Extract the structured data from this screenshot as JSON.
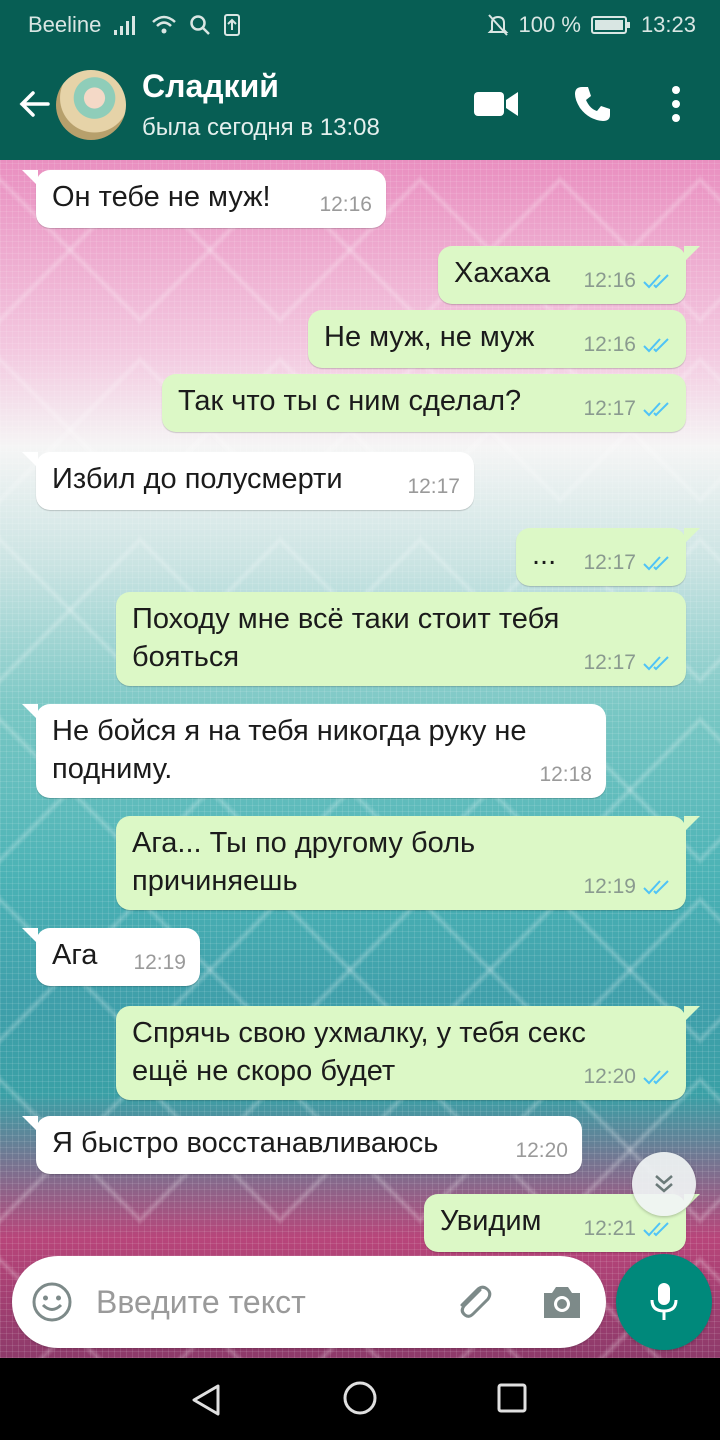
{
  "status_bar": {
    "carrier": "Beeline",
    "battery": "100 %",
    "time": "13:23",
    "icons": [
      "signal-icon",
      "wifi-icon",
      "search-icon",
      "upload-icon",
      "mute-icon",
      "battery-icon"
    ]
  },
  "header": {
    "contact_name": "Сладкий",
    "last_seen": "была сегодня в 13:08",
    "icons": [
      "back-arrow-icon",
      "video-call-icon",
      "phone-icon",
      "more-vert-icon"
    ]
  },
  "messages": [
    {
      "dir": "in",
      "text": "Он тебе не муж!",
      "time": "12:16"
    },
    {
      "dir": "out",
      "text": "Хахаха",
      "time": "12:16",
      "read": true
    },
    {
      "dir": "out",
      "text": "Не муж, не муж",
      "time": "12:16",
      "read": true
    },
    {
      "dir": "out",
      "text": "Так что ты с ним сделал?",
      "time": "12:17",
      "read": true
    },
    {
      "dir": "in",
      "text": "Избил до полусмерти",
      "time": "12:17"
    },
    {
      "dir": "out",
      "text": "...",
      "time": "12:17",
      "read": true
    },
    {
      "dir": "out",
      "text": "Походу мне всё таки стоит тебя бояться",
      "time": "12:17",
      "read": true
    },
    {
      "dir": "in",
      "text": "Не бойся я на тебя никогда руку не подниму.",
      "time": "12:18"
    },
    {
      "dir": "out",
      "text": "Ага... Ты по другому боль причиняешь",
      "time": "12:19",
      "read": true
    },
    {
      "dir": "in",
      "text": "Ага",
      "time": "12:19"
    },
    {
      "dir": "out",
      "text": "Спрячь свою ухмалку, у тебя секс ещё не скоро будет",
      "time": "12:20",
      "read": true
    },
    {
      "dir": "in",
      "text": "Я быстро восстанавливаюсь",
      "time": "12:20"
    },
    {
      "dir": "out",
      "text": "Увидим",
      "time": "12:21",
      "read": true
    }
  ],
  "composer": {
    "placeholder": "Введите текст",
    "icons": [
      "emoji-icon",
      "paperclip-icon",
      "camera-icon",
      "mic-icon"
    ]
  },
  "colors": {
    "header": "#075e54",
    "outgoing_bubble": "#dcf8c6",
    "incoming_bubble": "#ffffff",
    "read_ticks": "#4fc3f7",
    "mic_button": "#00897b"
  }
}
